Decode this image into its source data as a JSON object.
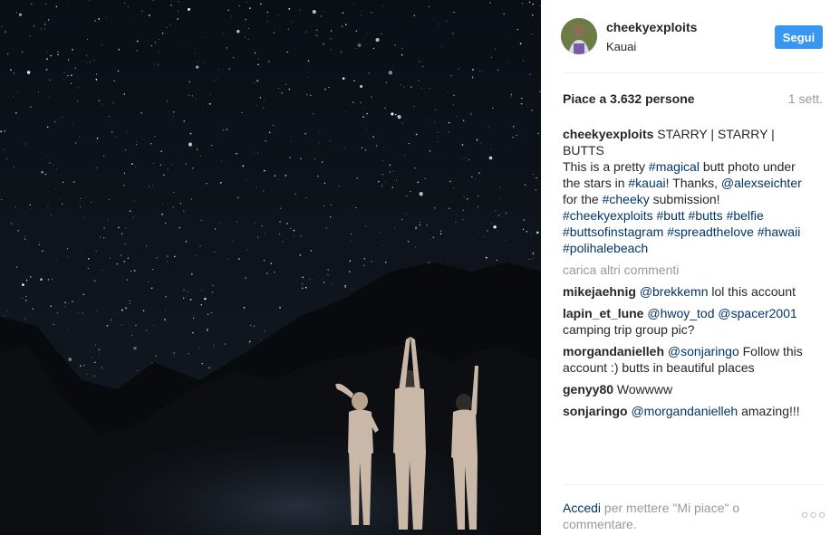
{
  "post": {
    "username": "cheekyexploits",
    "location": "Kauai",
    "follow_label": "Segui",
    "likes_text": "Piace a 3.632 persone",
    "time_ago": "1 sett."
  },
  "caption": {
    "user": "cheekyexploits",
    "p1": " STARRY | STARRY | BUTTS",
    "p2": "This is a pretty ",
    "h_magical": "#magical",
    "p3": " butt photo under the stars in ",
    "h_kauai": "#kauai",
    "p4": "! Thanks, ",
    "m_alex": "@alexseichter",
    "p5": " for the ",
    "h_cheeky": "#cheeky",
    "p6": " submission!",
    "tags": [
      "#cheekyexploits",
      "#butt",
      "#butts",
      "#belfie",
      "#buttsofinstagram",
      "#spreadthelove",
      "#hawaii",
      "#polihalebeach"
    ]
  },
  "load_more": "carica altri commenti",
  "comments": [
    {
      "user": "mikejaehnig",
      "mention": "@brekkemn",
      "text": " lol this account"
    },
    {
      "user": "lapin_et_lune",
      "mention": "@hwoy_tod",
      "mention2": "@spacer2001",
      "text": " camping trip group pic?"
    },
    {
      "user": "morgandanielleh",
      "mention": "@sonjaringo",
      "text": " Follow this account :) butts in beautiful places"
    },
    {
      "user": "genyy80",
      "text": " Wowwww"
    },
    {
      "user": "sonjaringo",
      "mention": "@morgandanielleh",
      "text": " amazing!!!"
    }
  ],
  "footer": {
    "login_label": "Accedi",
    "rest": " per mettere \"Mi piace\" o commentare."
  },
  "icons": {
    "more": "more-options-icon"
  },
  "colors": {
    "accent": "#3897f0",
    "link": "#003569",
    "muted": "#999999"
  }
}
